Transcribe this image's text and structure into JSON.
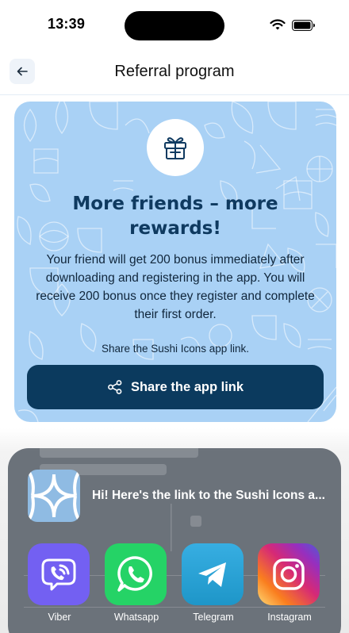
{
  "status_bar": {
    "time": "13:39"
  },
  "header": {
    "back_icon": "arrow-left-icon",
    "title": "Referral program"
  },
  "promo": {
    "icon": "gift-icon",
    "title": "More friends – more rewards!",
    "description": "Your friend will get 200 bonus immediately after downloading and registering in the app. You will receive 200 bonus once they register and complete their first order.",
    "share_hint": "Share the Sushi Icons app link.",
    "share_button_label": "Share the app link",
    "share_button_icon": "share-icon",
    "colors": {
      "card_background": "#a9d1f5",
      "accent": "#0b3a5e"
    }
  },
  "share_sheet": {
    "preview_text": "Hi! Here's the link to the Sushi Icons a...",
    "apps": [
      {
        "label": "Viber",
        "icon": "viber-icon",
        "color": "#7360f2"
      },
      {
        "label": "Whatsapp",
        "icon": "whatsapp-icon",
        "color": "#25d366"
      },
      {
        "label": "Telegram",
        "icon": "telegram-icon",
        "color": "#2aabee"
      },
      {
        "label": "Instagram",
        "icon": "instagram-icon",
        "color": "#e1306c"
      }
    ]
  }
}
